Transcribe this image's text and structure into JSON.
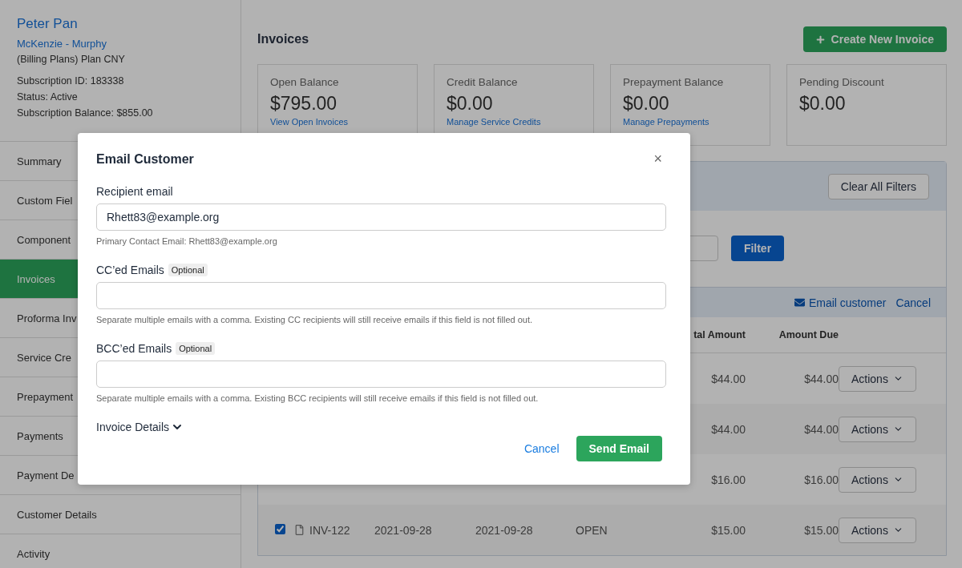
{
  "customer": {
    "name": "Peter Pan",
    "company": "McKenzie - Murphy",
    "plan": "(Billing Plans) Plan CNY",
    "details": [
      "Subscription ID: 183338",
      "Status: Active",
      "Subscription Balance: $855.00"
    ]
  },
  "sidebar": {
    "items": [
      {
        "label": "Summary",
        "selected": false
      },
      {
        "label": "Custom Fiel",
        "selected": false
      },
      {
        "label": "Component",
        "selected": false
      },
      {
        "label": "Invoices",
        "selected": true
      },
      {
        "label": "Proforma Inv",
        "selected": false
      },
      {
        "label": "Service Cre",
        "selected": false
      },
      {
        "label": "Prepayment",
        "selected": false
      },
      {
        "label": "Payments",
        "selected": false
      },
      {
        "label": "Payment De",
        "selected": false
      },
      {
        "label": "Customer Details",
        "selected": false
      },
      {
        "label": "Activity",
        "selected": false
      }
    ]
  },
  "page": {
    "title": "Invoices",
    "create_button": "Create New Invoice"
  },
  "cards": [
    {
      "label": "Open Balance",
      "amount": "$795.00",
      "link": "View Open Invoices"
    },
    {
      "label": "Credit Balance",
      "amount": "$0.00",
      "link": "Manage Service Credits"
    },
    {
      "label": "Prepayment Balance",
      "amount": "$0.00",
      "link": "Manage Prepayments"
    },
    {
      "label": "Pending Discount",
      "amount": "$0.00"
    }
  ],
  "filters": {
    "clear_button": "Clear All Filters",
    "filter_button": "Filter"
  },
  "bulk_bar": {
    "email_link": "Email customer",
    "cancel_link": "Cancel"
  },
  "table": {
    "columns": [
      "tal Amount",
      "Amount Due"
    ],
    "rows": [
      {
        "total": "$44.00",
        "due": "$44.00",
        "action": "Actions"
      },
      {
        "total": "$44.00",
        "due": "$44.00",
        "action": "Actions"
      },
      {
        "total": "$16.00",
        "due": "$16.00",
        "action": "Actions"
      },
      {
        "checked": true,
        "number": "INV-122",
        "issue_date": "2021-09-28",
        "due_date": "2021-09-28",
        "status": "OPEN",
        "total": "$15.00",
        "due": "$15.00",
        "action": "Actions"
      }
    ]
  },
  "modal": {
    "title": "Email Customer",
    "close": "×",
    "fields": [
      {
        "label": "Recipient email",
        "value": "Rhett83@example.org",
        "help": "Primary Contact Email: Rhett83@example.org"
      },
      {
        "label": "CC’ed Emails",
        "badge": "Optional",
        "help": "Separate multiple emails with a comma. Existing CC recipients will still receive emails if this field is not filled out."
      },
      {
        "label": "BCC’ed Emails",
        "badge": "Optional",
        "help": "Separate multiple emails with a comma. Existing BCC recipients will still receive emails if this field is not filled out."
      }
    ],
    "details_toggle": {
      "label": "Invoice Details",
      "expanded": false
    },
    "cancel": "Cancel",
    "submit": "Send Email"
  }
}
